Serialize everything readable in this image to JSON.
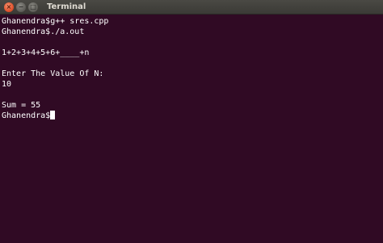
{
  "window": {
    "title": "Terminal",
    "controls": {
      "close_glyph": "×",
      "minimize_glyph": "−",
      "maximize_glyph": "□"
    }
  },
  "terminal": {
    "lines": [
      "Ghanendra$g++ sres.cpp",
      "Ghanendra$./a.out",
      "",
      "1+2+3+4+5+6+____+n",
      "",
      "Enter The Value Of N:",
      "10",
      "",
      "Sum = 55"
    ],
    "prompt": "Ghanendra$",
    "colors": {
      "background": "#300a24",
      "foreground": "#ffffff"
    }
  }
}
